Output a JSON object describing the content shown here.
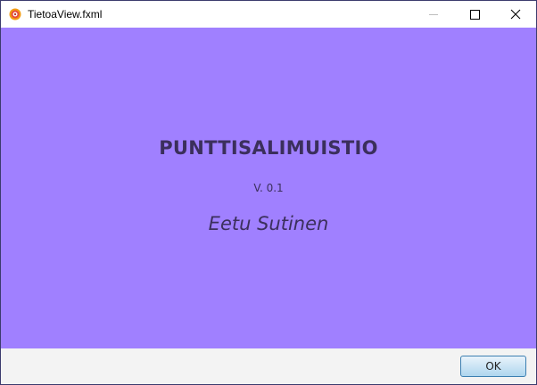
{
  "window": {
    "title": "TietoaView.fxml",
    "icon": "app-logo-icon",
    "controls": {
      "minimize_icon": "minimize-icon",
      "maximize_icon": "maximize-icon",
      "close_icon": "close-icon"
    }
  },
  "about": {
    "app_name": "PUNTTISALIMUISTIO",
    "version": "V. 0.1",
    "author": "Eetu Sutinen",
    "background_color": "#a080ff",
    "text_color": "#3b2f5c"
  },
  "footer": {
    "ok_label": "OK"
  }
}
